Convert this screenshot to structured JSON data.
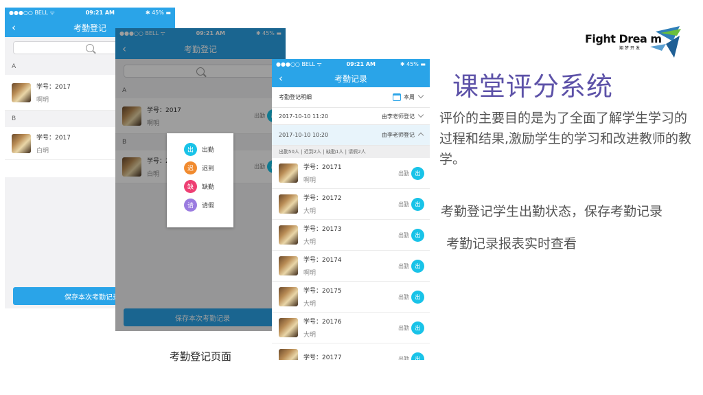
{
  "phones": {
    "status": {
      "carrier": "●●●○○ BELL ᯤ",
      "time": "09:21 AM",
      "battery": "✱ 45% ▬"
    }
  },
  "register": {
    "title": "考勤登记",
    "sections": [
      "A",
      "B"
    ],
    "students": [
      {
        "no": "学号：2017",
        "name": "啊明"
      },
      {
        "no": "学号：2017",
        "name": "白明"
      }
    ],
    "save_label": "保存本次考勤记录",
    "status_label": "出勤",
    "status_badge": "出"
  },
  "register_overlay": {
    "options": [
      {
        "glyph": "出",
        "label": "出勤",
        "color": "#19c3e8"
      },
      {
        "glyph": "迟",
        "label": "迟到",
        "color": "#f18b2f"
      },
      {
        "glyph": "缺",
        "label": "缺勤",
        "color": "#ee3f73"
      },
      {
        "glyph": "请",
        "label": "请假",
        "color": "#9a7be0"
      }
    ]
  },
  "records": {
    "title": "考勤记录",
    "detail_label": "考勤登记明细",
    "period": "本周",
    "entries": [
      {
        "time": "2017-10-10   11:20",
        "by": "由李老师登记"
      },
      {
        "time": "2017-10-10   10:20",
        "by": "由李老师登记"
      }
    ],
    "summary": "出勤50人  |  迟到2人  |  缺勤1人  |  请假2人",
    "students": [
      {
        "no": "学号：20171",
        "name": "啊明"
      },
      {
        "no": "学号：20172",
        "name": "大明"
      },
      {
        "no": "学号：20173",
        "name": "大明"
      },
      {
        "no": "学号：20174",
        "name": "啊明"
      },
      {
        "no": "学号：20175",
        "name": "大明"
      },
      {
        "no": "学号：20176",
        "name": "大明"
      },
      {
        "no": "学号：20177",
        "name": ""
      }
    ],
    "status_label": "出勤",
    "status_badge": "出"
  },
  "caption": "考勤登记页面",
  "logo": {
    "main": "Fight Drea m",
    "sub": "翔梦开发"
  },
  "heading": "课堂评分系统",
  "paragraph": "评价的主要目的是为了全面了解学生学习的过程和结果,激励学生的学习和改进教师的教学。",
  "line2": "考勤登记学生出勤状态，保存考勤记录",
  "line3": "考勤记录报表实时查看"
}
